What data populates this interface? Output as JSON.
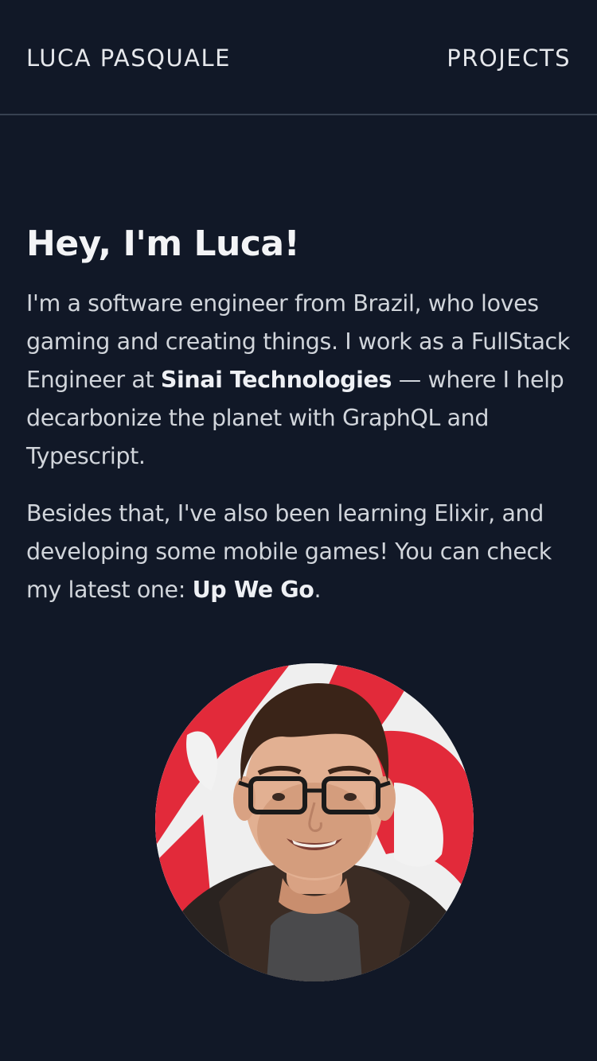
{
  "header": {
    "brand": "LUCA PASQUALE",
    "nav_projects": "PROJECTS"
  },
  "intro": {
    "heading": "Hey, I'm Luca!",
    "p1_before": "I'm a software engineer from Brazil, who loves gaming and creating things. I work as a FullStack Engineer at ",
    "company": "Sinai Technologies",
    "p1_after": " — where I help decarbonize the planet with GraphQL and Typescript.",
    "p2_before": "Besides that, I've also been learning Elixir, and developing some mobile games! You can check my latest one: ",
    "game": "Up We Go",
    "p2_after": "."
  },
  "colors": {
    "background": "#111827",
    "text": "#d1d5db",
    "divider": "#374151"
  },
  "avatar": {
    "icon": "profile-photo"
  }
}
